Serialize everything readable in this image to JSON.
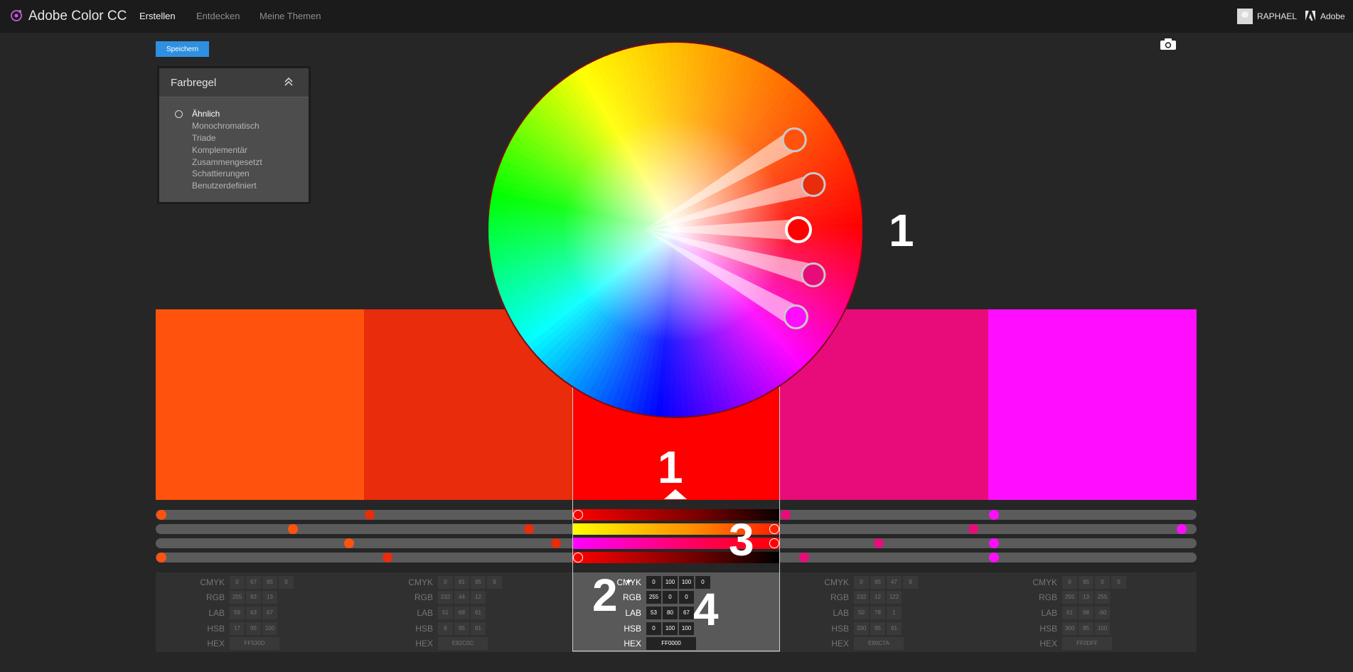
{
  "app": {
    "title": "Adobe Color CC"
  },
  "nav": [
    {
      "label": "Erstellen",
      "active": true
    },
    {
      "label": "Entdecken",
      "active": false
    },
    {
      "label": "Meine Themen",
      "active": false
    }
  ],
  "user": {
    "name": "RAPHAEL",
    "brand": "Adobe",
    "icons": [
      "avatar-icon",
      "adobe-icon"
    ]
  },
  "toolbar": {
    "save_label": "Speichern",
    "camera_icon": "camera-icon"
  },
  "color_rule": {
    "title": "Farbregel",
    "collapse_icon": "chevron-double-up-icon",
    "options": [
      "Ähnlich",
      "Monochromatisch",
      "Triade",
      "Komplementär",
      "Zusammengesetzt",
      "Schattierungen",
      "Benutzerdefiniert"
    ],
    "selected": "Ähnlich"
  },
  "swatches": [
    {
      "hex": "FF530D",
      "color": "#FF530D",
      "cmyk": [
        "0",
        "67",
        "95",
        "0"
      ],
      "rgb": [
        "255",
        "83",
        "13"
      ],
      "lab": [
        "59",
        "63",
        "67"
      ],
      "hsb": [
        "17",
        "95",
        "100"
      ]
    },
    {
      "hex": "E82C0C",
      "color": "#E82C0C",
      "cmyk": [
        "0",
        "81",
        "95",
        "9"
      ],
      "rgb": [
        "232",
        "44",
        "12"
      ],
      "lab": [
        "51",
        "68",
        "61"
      ],
      "hsb": [
        "9",
        "95",
        "91"
      ]
    },
    {
      "hex": "FF0000",
      "color": "#FF0000",
      "cmyk": [
        "0",
        "100",
        "100",
        "0"
      ],
      "rgb": [
        "255",
        "0",
        "0"
      ],
      "lab": [
        "53",
        "80",
        "67"
      ],
      "hsb": [
        "0",
        "100",
        "100"
      ]
    },
    {
      "hex": "E80C7A",
      "color": "#E80C7A",
      "cmyk": [
        "0",
        "95",
        "47",
        "9"
      ],
      "rgb": [
        "232",
        "12",
        "122"
      ],
      "lab": [
        "50",
        "78",
        "1"
      ],
      "hsb": [
        "330",
        "95",
        "91"
      ]
    },
    {
      "hex": "FF0DFF",
      "color": "#FF0DFF",
      "cmyk": [
        "0",
        "95",
        "0",
        "0"
      ],
      "rgb": [
        "255",
        "13",
        "255"
      ],
      "lab": [
        "61",
        "98",
        "-60"
      ],
      "hsb": [
        "300",
        "95",
        "100"
      ]
    }
  ],
  "selected_swatch": 2,
  "value_labels": {
    "cmyk": "CMYK",
    "rgb": "RGB",
    "lab": "LAB",
    "hsb": "HSB",
    "hex": "HEX"
  },
  "annotations": {
    "wheel_marker": "1",
    "swatch_marker": "1",
    "mode_marker": "2",
    "slider_marker": "3",
    "values_marker": "4"
  },
  "colors": {
    "accent": "#2F8FE0",
    "background": "#262626",
    "topbar": "#1B1B1B"
  }
}
